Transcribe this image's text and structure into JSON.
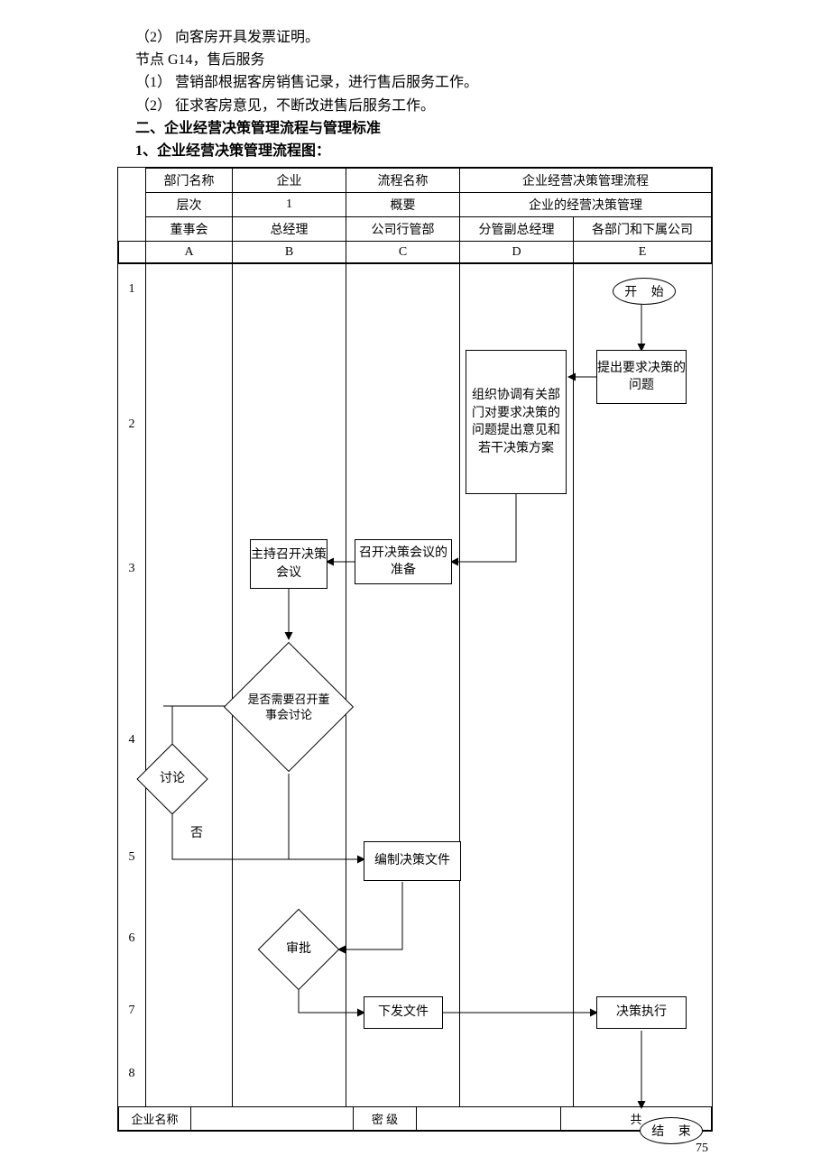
{
  "text": {
    "l1": "（2） 向客房开具发票证明。",
    "l2": "节点 G14，售后服务",
    "l3": "（1） 营销部根据客房销售记录，进行售后服务工作。",
    "l4": "（2） 征求客房意见，不断改进售后服务工作。",
    "l5": "二、企业经营决策管理流程与管理标准",
    "l6": "1、企业经营决策管理流程图："
  },
  "tbl": {
    "r1c1": "部门名称",
    "r1c2": "企业",
    "r1c3": "流程名称",
    "r1c4": "企业经营决策管理流程",
    "r2c1": "层次",
    "r2c2": "1",
    "r2c3": "概要",
    "r2c4": "企业的经营决策管理",
    "r3c1": "董事会",
    "r3c2": "总经理",
    "r3c3": "公司行管部",
    "r3c4": "分管副总经理",
    "r3c5": "各部门和下属公司",
    "r4c1": "A",
    "r4c2": "B",
    "r4c3": "C",
    "r4c4": "D",
    "r4c5": "E"
  },
  "rows": {
    "n1": "1",
    "n2": "2",
    "n3": "3",
    "n4": "4",
    "n5": "5",
    "n6": "6",
    "n7": "7",
    "n8": "8"
  },
  "nodes": {
    "start": "开  始",
    "e2": "提出要求决策的问题",
    "d2": "组织协调有关部门对要求决策的问题提出意见和若干决策方案",
    "c3": "召开决策会议的准备",
    "b3": "主持召开决策会议",
    "b4": "是否需要召开董事会讨论",
    "a45": "讨论",
    "nolabel": "否",
    "c5": "编制决策文件",
    "b6": "审批",
    "c7": "下发文件",
    "e7": "决策执行",
    "end": "结  束"
  },
  "footer": {
    "c1": "企业名称",
    "c2": "",
    "c3": "密  级",
    "c4": "",
    "c5": "共"
  },
  "page": "75"
}
